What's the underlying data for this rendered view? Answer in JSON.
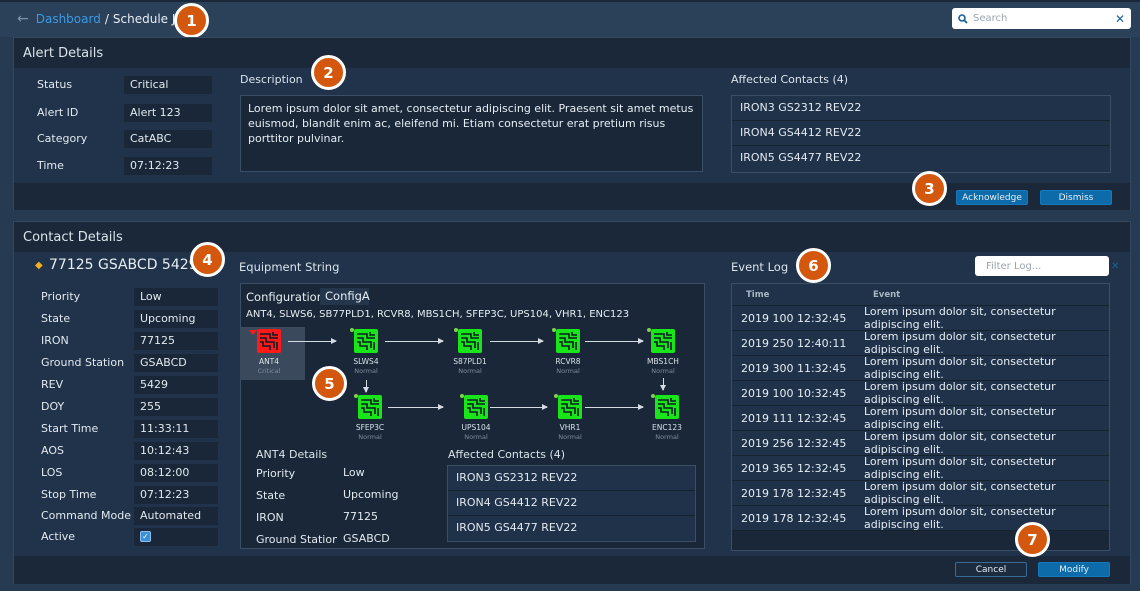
{
  "breadcrumb": {
    "parent": "Dashboard",
    "separator": "/",
    "current": "Schedule Job"
  },
  "search": {
    "placeholder": "Search",
    "value": ""
  },
  "badges": [
    "1",
    "2",
    "3",
    "4",
    "5",
    "6",
    "7"
  ],
  "alert_details": {
    "title": "Alert Details",
    "fields": [
      {
        "label": "Status",
        "value": "Critical"
      },
      {
        "label": "Alert ID",
        "value": "Alert 123"
      },
      {
        "label": "Category",
        "value": "CatABC"
      },
      {
        "label": "Time",
        "value": "07:12:23"
      }
    ],
    "description_label": "Description",
    "description": "Lorem ipsum dolor sit amet, consectetur adipiscing elit. Praesent sit amet metus euismod, blandit enim ac, eleifend mi. Etiam consectetur erat pretium risus porttitor pulvinar.",
    "affected_label": "Affected Contacts (4)",
    "affected_contacts": [
      "IRON3 GS2312 REV22",
      "IRON4 GS4412 REV22",
      "IRON5 GS4477 REV22"
    ],
    "acknowledge_label": "Acknowledge",
    "dismiss_label": "Dismiss"
  },
  "contact_details": {
    "title": "Contact Details",
    "contact_name": "77125 GSABCD 5429",
    "status_color": "#f2b01e",
    "fields": [
      {
        "label": "Priority",
        "value": "Low"
      },
      {
        "label": "State",
        "value": "Upcoming"
      },
      {
        "label": "IRON",
        "value": "77125"
      },
      {
        "label": "Ground Station",
        "value": "GSABCD"
      },
      {
        "label": "REV",
        "value": "5429"
      },
      {
        "label": "DOY",
        "value": "255"
      },
      {
        "label": "Start Time",
        "value": "11:33:11"
      },
      {
        "label": "AOS",
        "value": "10:12:43"
      },
      {
        "label": "LOS",
        "value": "08:12:00"
      },
      {
        "label": "Stop Time",
        "value": "07:12:23"
      },
      {
        "label": "Command Mode",
        "value": "Automated"
      }
    ],
    "active_label": "Active",
    "active_checked": true,
    "cancel_label": "Cancel",
    "modify_label": "Modify"
  },
  "equipment": {
    "title": "Equipment String",
    "config_label": "Configuration",
    "config_value": "ConfigA",
    "string": "ANT4, SLWS6, SB77PLD1, RCVR8, MBS1CH, SFEP3C, UPS104, VHR1, ENC123",
    "critical_color": "#ff1a1a",
    "normal_color": "#19e619",
    "nodes": [
      {
        "name": "ANT4",
        "status": "Critical"
      },
      {
        "name": "SLWS4",
        "status": "Normal"
      },
      {
        "name": "S87PLD1",
        "status": "Normal"
      },
      {
        "name": "RCVR8",
        "status": "Normal"
      },
      {
        "name": "MBS1CH",
        "status": "Normal"
      },
      {
        "name": "SFEP3C",
        "status": "Normal"
      },
      {
        "name": "UPS104",
        "status": "Normal"
      },
      {
        "name": "VHR1",
        "status": "Normal"
      },
      {
        "name": "ENC123",
        "status": "Normal"
      }
    ],
    "selected_details_title": "ANT4 Details",
    "selected_fields": [
      {
        "label": "Priority",
        "value": "Low"
      },
      {
        "label": "State",
        "value": "Upcoming"
      },
      {
        "label": "IRON",
        "value": "77125"
      },
      {
        "label": "Ground Station",
        "value": "GSABCD"
      }
    ],
    "affected_label": "Affected Contacts (4)",
    "affected_contacts": [
      "IRON3 GS2312 REV22",
      "IRON4 GS4412 REV22",
      "IRON5 GS4477 REV22"
    ]
  },
  "event_log": {
    "title": "Event Log",
    "filter_placeholder": "Filter Log...",
    "columns": [
      "Time",
      "Event"
    ],
    "rows": [
      {
        "time": "2019 100 12:32:45",
        "event": "Lorem ipsum dolor sit, consectetur adipiscing elit."
      },
      {
        "time": "2019 250 12:40:11",
        "event": "Lorem ipsum dolor sit, consectetur adipiscing elit."
      },
      {
        "time": "2019 300 11:32:45",
        "event": "Lorem ipsum dolor sit, consectetur adipiscing elit."
      },
      {
        "time": "2019 100 10:32:45",
        "event": "Lorem ipsum dolor sit, consectetur adipiscing elit."
      },
      {
        "time": "2019 111 12:32:45",
        "event": "Lorem ipsum dolor sit, consectetur adipiscing elit."
      },
      {
        "time": "2019 256 12:32:45",
        "event": "Lorem ipsum dolor sit, consectetur adipiscing elit."
      },
      {
        "time": "2019 365 12:32:45",
        "event": "Lorem ipsum dolor sit, consectetur adipiscing elit."
      },
      {
        "time": "2019 178 12:32:45",
        "event": "Lorem ipsum dolor sit, consectetur adipiscing elit."
      },
      {
        "time": "2019 178 12:32:45",
        "event": "Lorem ipsum dolor sit, consectetur adipiscing elit."
      }
    ]
  }
}
